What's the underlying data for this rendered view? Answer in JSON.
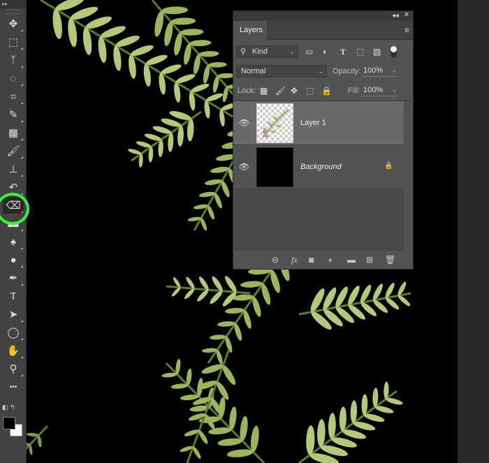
{
  "toolbar": {
    "tools": [
      {
        "name": "move-tool",
        "glyph": "✥"
      },
      {
        "name": "marquee-tool",
        "glyph": "⬚"
      },
      {
        "name": "lasso-tool",
        "glyph": "ᛉ"
      },
      {
        "name": "quick-selection-tool",
        "glyph": "◌"
      },
      {
        "name": "crop-tool",
        "glyph": "⌗"
      },
      {
        "name": "eyedropper-tool",
        "glyph": "✎"
      },
      {
        "name": "healing-brush-tool",
        "glyph": "▦"
      },
      {
        "name": "brush-tool",
        "glyph": "🖌"
      },
      {
        "name": "stamp-tool",
        "glyph": "⊥"
      },
      {
        "name": "history-brush-tool",
        "glyph": "↶"
      },
      {
        "name": "eraser-tool",
        "glyph": "⌫"
      },
      {
        "name": "gradient-tool",
        "glyph": "▬"
      },
      {
        "name": "blur-tool",
        "glyph": "♠"
      },
      {
        "name": "dodge-tool",
        "glyph": "●"
      },
      {
        "name": "pen-tool",
        "glyph": "✒"
      },
      {
        "name": "type-tool",
        "glyph": "T"
      },
      {
        "name": "path-selection-tool",
        "glyph": "➤"
      },
      {
        "name": "ellipse-tool",
        "glyph": "◯"
      },
      {
        "name": "hand-tool",
        "glyph": "✋"
      },
      {
        "name": "zoom-tool",
        "glyph": "⚲"
      },
      {
        "name": "more-tools",
        "glyph": "•••"
      }
    ],
    "active_tool": "eraser-tool",
    "foreground_color": "#000000",
    "background_color": "#ffffff",
    "highlight_color": "#3ef03e"
  },
  "panel": {
    "tab": "Layers",
    "filter_kind": "Kind",
    "blend_mode": "Normal",
    "opacity_label": "Opacity:",
    "opacity": "100%",
    "lock_label": "Lock:",
    "fill_label": "Fill:",
    "fill": "100%",
    "layers": [
      {
        "name": "Layer 1",
        "visible": true,
        "selected": true,
        "locked": false
      },
      {
        "name": "Background",
        "visible": true,
        "selected": false,
        "locked": true
      }
    ]
  }
}
